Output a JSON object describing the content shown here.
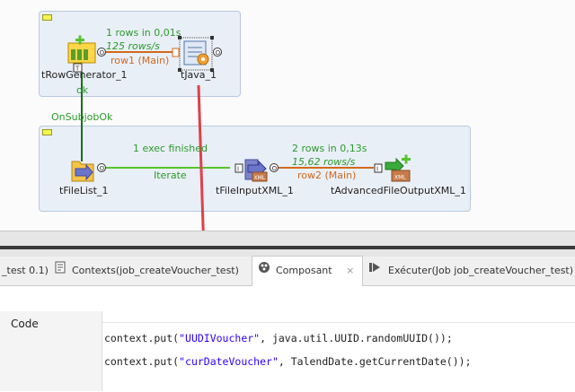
{
  "canvas": {
    "subjob1": {
      "components": {
        "row_generator": "tRowGenerator_1",
        "java": "tJava_1"
      },
      "flow": {
        "rows_status": "1 rows in 0,01s",
        "rate": "125 rows/s",
        "row_label": "row1 (Main)"
      },
      "ok_label": "ok"
    },
    "subjob_link": "OnSubjobOk",
    "subjob2": {
      "components": {
        "file_list": "tFileList_1",
        "file_input_xml": "tFileInputXML_1",
        "advanced_output_xml": "tAdvancedFileOutputXML_1"
      },
      "iterate": {
        "status": "1 exec finished",
        "label": "Iterate"
      },
      "flow": {
        "rows_status": "2 rows in 0,13s",
        "rate": "15,62 rows/s",
        "row_label": "row2 (Main)"
      }
    },
    "colors": {
      "green": "#2c9a2c",
      "orange": "#d2691e",
      "arrow_red": "#e0404a"
    }
  },
  "tabs": [
    {
      "label": "_test 0.1)",
      "icon": null
    },
    {
      "label": "Contexts(job_createVoucher_test)",
      "icon": "contexts-icon"
    },
    {
      "label": "Composant",
      "icon": "component-icon",
      "active": true,
      "close": "×"
    },
    {
      "label": "Exécuter(Job job_createVoucher_test)",
      "icon": "run-icon"
    }
  ],
  "panel": {
    "code_label": "Code",
    "code_lines": [
      {
        "before": "context.put(",
        "string": "\"UUDIVoucher\"",
        "after": ", java.util.UUID.randomUUID());"
      },
      {
        "before": "context.put(",
        "string": "\"curDateVoucher\"",
        "after": ", TalendDate.getCurrentDate());"
      }
    ]
  }
}
